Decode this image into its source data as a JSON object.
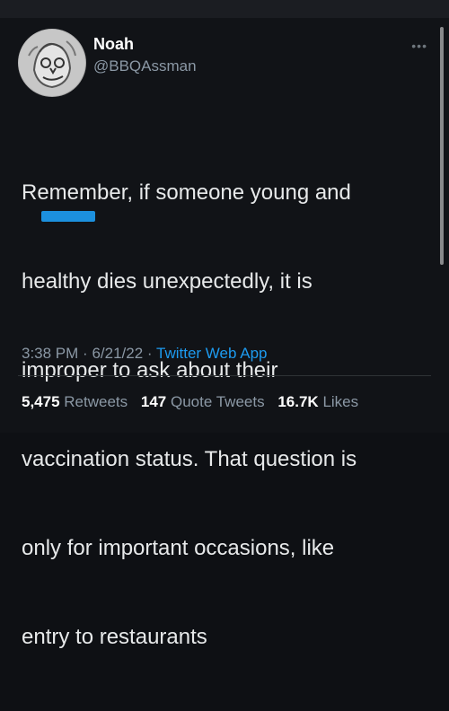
{
  "user": {
    "name": "Noah",
    "handle": "@BBQAssman"
  },
  "tweet": {
    "lines": [
      "Remember, if someone young and",
      "healthy dies unexpectedly, it is",
      "improper to ask about their",
      "vaccination status. That question is",
      "only for important occasions, like",
      "entry to restaurants"
    ],
    "time": "3:38 PM",
    "date": "6/21/22",
    "separator": "·",
    "source": "Twitter Web App"
  },
  "stats": [
    {
      "count": "5,475",
      "label": "Retweets"
    },
    {
      "count": "147",
      "label": "Quote Tweets"
    },
    {
      "count": "16.7K",
      "label": "Likes"
    }
  ],
  "icons": {
    "more": "more-icon",
    "avatar": "avatar-image"
  },
  "colors": {
    "background": "#111317",
    "text": "#e7e9ea",
    "muted": "#8b98a5",
    "accent": "#1d9bf0"
  }
}
